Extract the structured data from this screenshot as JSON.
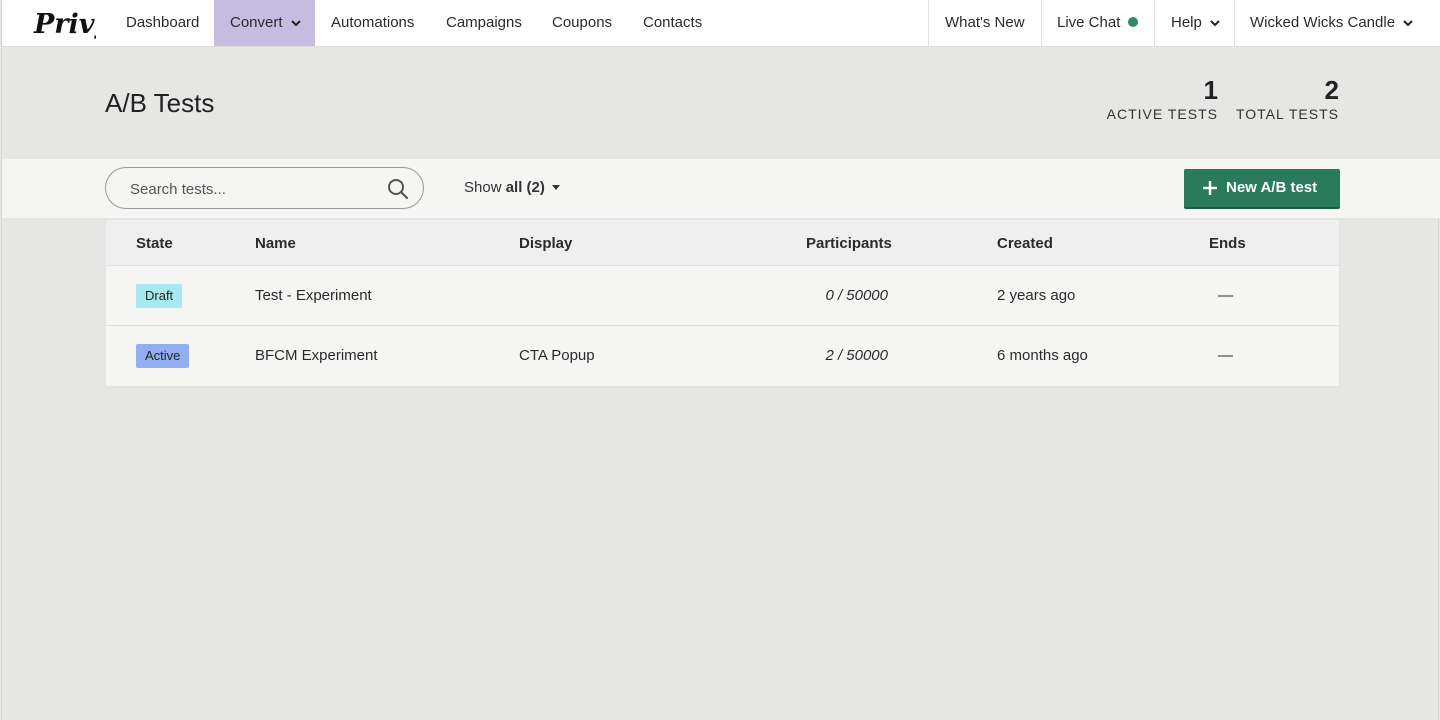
{
  "nav": {
    "logo_text": "Privy",
    "items": [
      {
        "label": "Dashboard"
      },
      {
        "label": "Convert",
        "active": true,
        "dropdown": true
      },
      {
        "label": "Automations"
      },
      {
        "label": "Campaigns"
      },
      {
        "label": "Coupons"
      },
      {
        "label": "Contacts"
      }
    ],
    "whats_new": "What's New",
    "live_chat": "Live Chat",
    "live_chat_status_color": "#2e8b6a",
    "help": "Help",
    "account": "Wicked Wicks Candle"
  },
  "header": {
    "title": "A/B Tests",
    "active_tests_count": "1",
    "active_tests_label": "ACTIVE TESTS",
    "total_tests_count": "2",
    "total_tests_label": "TOTAL TESTS"
  },
  "toolbar": {
    "search_placeholder": "Search tests...",
    "show_prefix": "Show",
    "show_value": "all (2)",
    "new_button_label": "New A/B test",
    "accent_color": "#2a7a5d"
  },
  "table": {
    "columns": {
      "state": "State",
      "name": "Name",
      "display": "Display",
      "participants": "Participants",
      "created": "Created",
      "ends": "Ends"
    },
    "rows": [
      {
        "state": "Draft",
        "state_color": "#a8e8ef",
        "name": "Test - Experiment",
        "display": "",
        "participants": "0 / 50000",
        "created": "2 years ago",
        "ends": "—"
      },
      {
        "state": "Active",
        "state_color": "#93aef0",
        "name": "BFCM Experiment",
        "display": "CTA Popup",
        "participants": "2 / 50000",
        "created": "6 months ago",
        "ends": "—"
      }
    ]
  }
}
